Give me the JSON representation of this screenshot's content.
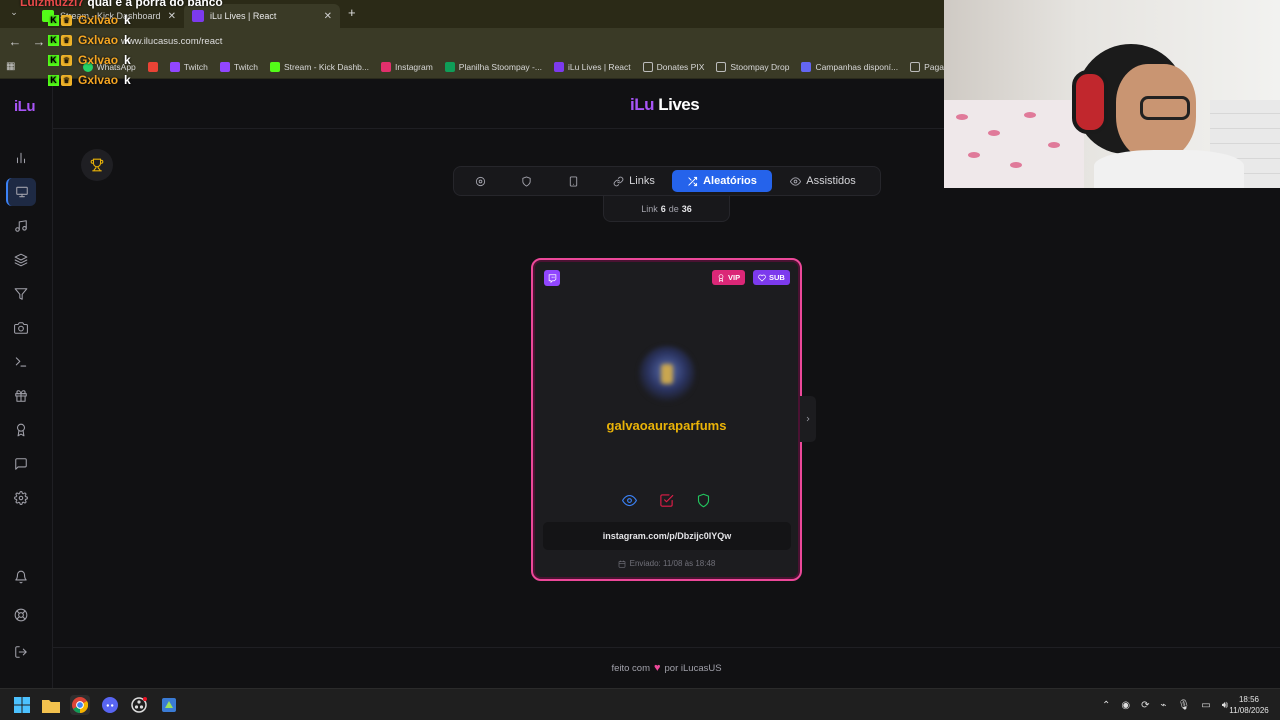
{
  "browser": {
    "tabs": [
      {
        "label": "Stream - Kick Dashboard"
      },
      {
        "label": "iLu Lives | React"
      }
    ],
    "new_tab": "+",
    "url": "www.ilucasus.com/react",
    "bookmarks": [
      {
        "label": "WhatsApp",
        "color": "#25d366"
      },
      {
        "label": "",
        "color": "#ea4335"
      },
      {
        "label": "Twitch",
        "color": "#9146ff"
      },
      {
        "label": "Twitch",
        "color": "#9146ff"
      },
      {
        "label": "Stream - Kick Dashb...",
        "color": "#53fc18"
      },
      {
        "label": "Instagram",
        "color": "#e1306c"
      },
      {
        "label": "Planilha Stoompay -...",
        "color": "#0f9d58"
      },
      {
        "label": "iLu Lives | React",
        "color": "#7c3aed"
      },
      {
        "label": "Donates PIX",
        "color": "#9a9a9a"
      },
      {
        "label": "Stoompay Drop",
        "color": "#9a9a9a"
      },
      {
        "label": "Campanhas disponí...",
        "color": "#6366f1"
      },
      {
        "label": "Paga",
        "color": "#9a9a9a"
      }
    ]
  },
  "chat": {
    "top_line": {
      "user": "Luizmuzzi7",
      "message": "qual é a porra do banco"
    },
    "lines": [
      {
        "user": "Gxlvao",
        "message": "k"
      },
      {
        "user": "Gxlvao",
        "message": "k"
      },
      {
        "user": "Gxlvao",
        "message": "k"
      },
      {
        "user": "Gxlvao",
        "message": "k"
      }
    ]
  },
  "app": {
    "logo": "iLu",
    "brand_prefix": "iLu",
    "brand_suffix": "Lives",
    "toolbar": {
      "links_label": "Links",
      "random_label": "Aleatórios",
      "watched_label": "Assistidos"
    },
    "counter": {
      "prefix": "Link",
      "current": "6",
      "of": "de",
      "total": "36"
    },
    "card": {
      "badges": {
        "vip": "VIP",
        "sub": "SUB"
      },
      "username": "galvaoauraparfums",
      "link": "instagram.com/p/Dbzijc0IYQw",
      "sent": "Enviado: 11/08 às 18:48"
    },
    "footer": {
      "prefix": "feito com",
      "suffix": "por iLucasUS"
    }
  },
  "taskbar": {
    "time": "18:56",
    "date": "11/08/2026"
  }
}
